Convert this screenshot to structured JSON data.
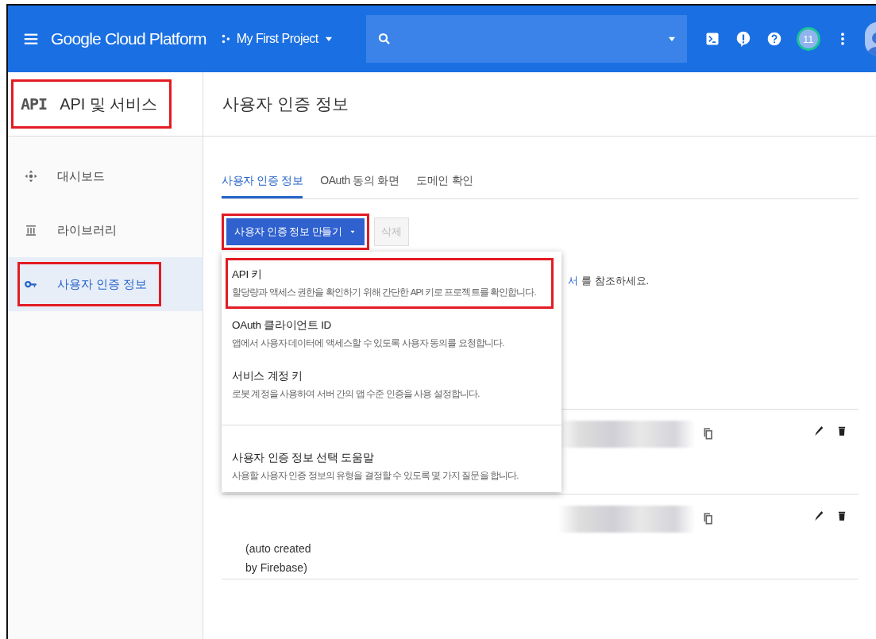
{
  "topbar": {
    "brand": "Google Cloud Platform",
    "project": "My First Project",
    "badge": "11"
  },
  "sidebar": {
    "logo": "API",
    "title": "API 및 서비스",
    "highlighted": true,
    "items": [
      {
        "label": "대시보드",
        "kind": "dashboard",
        "selected": false,
        "highlighted": false
      },
      {
        "label": "라이브러리",
        "kind": "library",
        "selected": false,
        "highlighted": false
      },
      {
        "label": "사용자 인증 정보",
        "kind": "key",
        "selected": true,
        "highlighted": true
      }
    ]
  },
  "main": {
    "title": "사용자 인증 정보",
    "tabs": [
      {
        "label": "사용자 인증 정보",
        "selected": true
      },
      {
        "label": "OAuth 동의 화면",
        "selected": false
      },
      {
        "label": "도메인 확인",
        "selected": false
      }
    ],
    "create_button": {
      "label": "사용자 인증 정보 만들기",
      "highlighted": true
    },
    "delete_button": {
      "label": "삭제",
      "disabled": true
    },
    "note": {
      "link": "서",
      "text": "를 참조하세요."
    },
    "rows": [
      {
        "kind": "key"
      },
      {
        "kind": "key",
        "name": "(auto created by Firebase)"
      }
    ],
    "menu": [
      {
        "kind": "option",
        "title": "API 키",
        "description": "할당량과 액세스 권한을 확인하기 위해 간단한 API 키로 프로젝트를 확인합니다.",
        "highlighted": true
      },
      {
        "kind": "option",
        "title": "OAuth 클라이언트 ID",
        "description": "앱에서 사용자 데이터에 액세스할 수 있도록 사용자 동의를 요청합니다.",
        "highlighted": false
      },
      {
        "kind": "option",
        "title": "서비스 계정 키",
        "description": "로봇 계정을 사용하여 서버 간의 앱 수준 인증을 사용 설정합니다.",
        "highlighted": false
      },
      {
        "kind": "help",
        "title": "사용자 인증 정보 선택 도움말",
        "description": "사용할 사용자 인증 정보의 유형을 결정할 수 있도록 몇 가지 질문을 합니다.",
        "highlighted": false
      }
    ]
  }
}
